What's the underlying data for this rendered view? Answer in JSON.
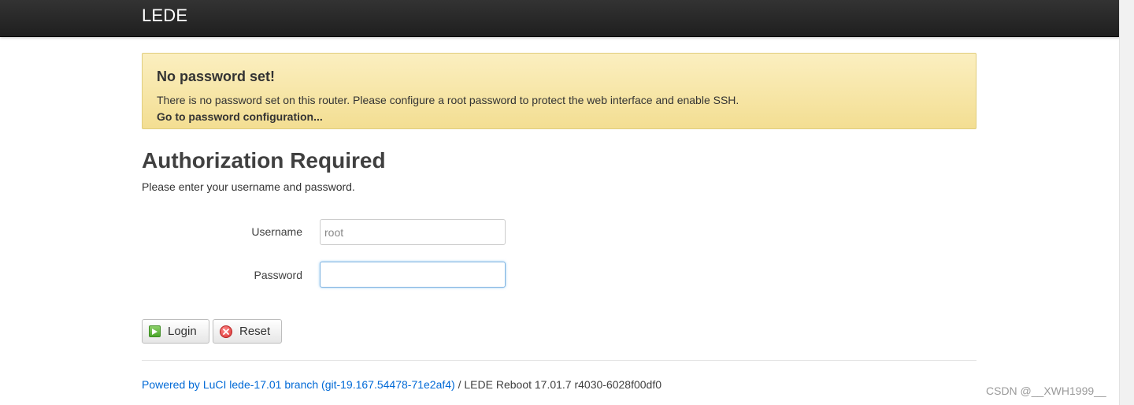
{
  "header": {
    "brand": "LEDE"
  },
  "alert": {
    "title": "No password set!",
    "text": "There is no password set on this router. Please configure a root password to protect the web interface and enable SSH.",
    "link": "Go to password configuration..."
  },
  "main": {
    "title": "Authorization Required",
    "subtitle": "Please enter your username and password."
  },
  "form": {
    "username_label": "Username",
    "username_placeholder": "root",
    "password_label": "Password",
    "password_value": ""
  },
  "buttons": {
    "login": "Login",
    "reset": "Reset"
  },
  "footer": {
    "link_text": "Powered by LuCI lede-17.01 branch (git-19.167.54478-71e2af4)",
    "suffix": " / LEDE Reboot 17.01.7 r4030-6028f00df0"
  },
  "watermark": "CSDN @__XWH1999__",
  "colors": {
    "topbar": "#262626",
    "alert_bg": "#f7e8a9",
    "link": "#0069d6"
  }
}
